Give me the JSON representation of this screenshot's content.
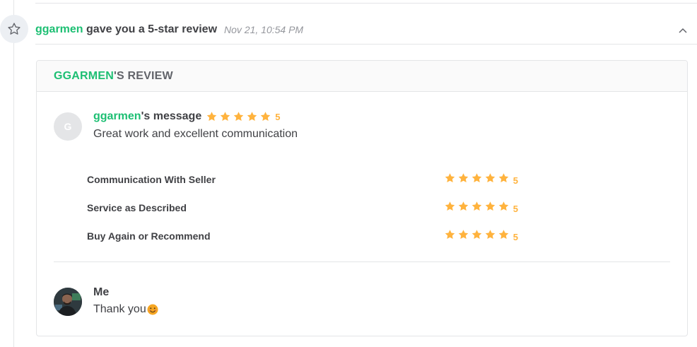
{
  "event": {
    "username": "ggarmen",
    "action_text": " gave you a 5-star review",
    "time": "Nov 21, 10:54 PM",
    "icon": "star-outline-icon",
    "collapse_icon": "chevron-up-icon"
  },
  "review": {
    "header_user": "GGARMEN",
    "header_suffix": "'S REVIEW",
    "avatar_initial": "G",
    "message_user": "ggarmen",
    "message_suffix": "'s message",
    "overall_rating": "5",
    "overall_rating_value": 5,
    "message": "Great work and excellent communication",
    "breakdown": [
      {
        "label": "Communication With Seller",
        "rating": "5",
        "rating_value": 5
      },
      {
        "label": "Service as Described",
        "rating": "5",
        "rating_value": 5
      },
      {
        "label": "Buy Again or Recommend",
        "rating": "5",
        "rating_value": 5
      }
    ]
  },
  "reply": {
    "author": "Me",
    "text": "Thank you",
    "emoji": "smiling-face-icon"
  },
  "colors": {
    "accent_green": "#1dbf73",
    "star": "#ffb33e",
    "text": "#404145",
    "muted": "#95979d",
    "border": "#e4e5e7"
  }
}
